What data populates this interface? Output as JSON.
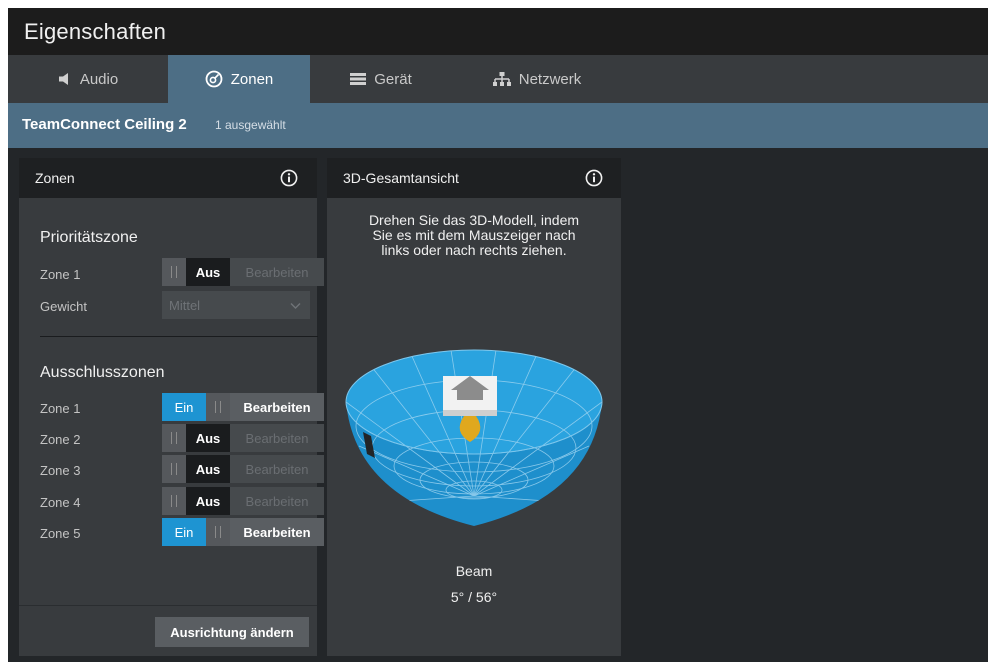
{
  "window": {
    "title": "Eigenschaften"
  },
  "tabs": [
    {
      "label": "Audio",
      "icon": "speaker-icon",
      "active": false
    },
    {
      "label": "Zonen",
      "icon": "zones-icon",
      "active": true
    },
    {
      "label": "Gerät",
      "icon": "device-icon",
      "active": false
    },
    {
      "label": "Netzwerk",
      "icon": "network-icon",
      "active": false
    }
  ],
  "device": {
    "name": "TeamConnect Ceiling 2",
    "selected": "1 ausgewählt"
  },
  "zones_panel": {
    "title": "Zonen",
    "priority": {
      "heading": "Prioritätszone",
      "zone_label": "Zone 1",
      "zone_state": "Aus",
      "edit_label": "Bearbeiten",
      "weight_label": "Gewicht",
      "weight_value": "Mittel"
    },
    "exclusion": {
      "heading": "Ausschlusszonen",
      "zones": [
        {
          "label": "Zone 1",
          "state": "Ein",
          "on": true,
          "edit": "Bearbeiten"
        },
        {
          "label": "Zone 2",
          "state": "Aus",
          "on": false,
          "edit": "Bearbeiten"
        },
        {
          "label": "Zone 3",
          "state": "Aus",
          "on": false,
          "edit": "Bearbeiten"
        },
        {
          "label": "Zone 4",
          "state": "Aus",
          "on": false,
          "edit": "Bearbeiten"
        },
        {
          "label": "Zone 5",
          "state": "Ein",
          "on": true,
          "edit": "Bearbeiten"
        }
      ]
    },
    "orientation_button": "Ausrichtung ändern"
  },
  "view_panel": {
    "title": "3D-Gesamtansicht",
    "instructions": [
      "Drehen Sie das 3D-Modell, indem",
      "Sie es mit dem Mauszeiger nach",
      "links oder nach rechts ziehen."
    ],
    "beam_label": "Beam",
    "beam_value": "5° / 56°"
  },
  "colors": {
    "accent": "#1e94d2",
    "header_blue": "#4d6e85",
    "panel_bg": "#383b3e",
    "bowl_blue": "#1e94d2",
    "beam_yellow": "#e0a81e"
  }
}
